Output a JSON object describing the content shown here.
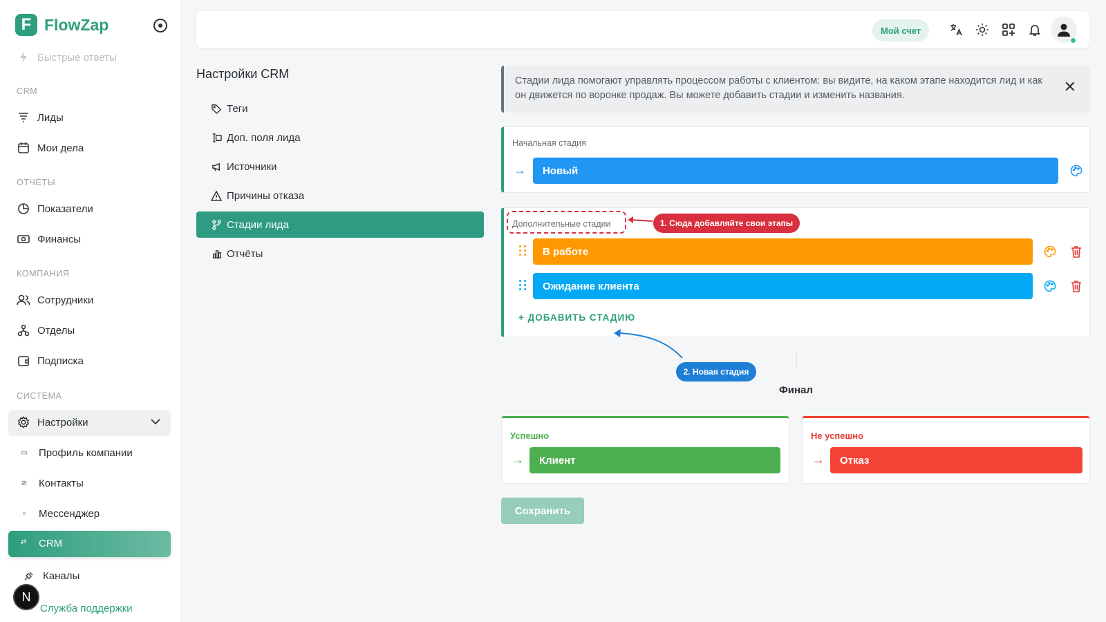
{
  "app": {
    "name": "FlowZap",
    "logo_letter": "F"
  },
  "sidebar": {
    "quick_replies": "Быстрые ответы",
    "sections": {
      "crm": "CRM",
      "reports": "ОТЧЁТЫ",
      "company": "КОМПАНИЯ",
      "system": "СИСТЕМА"
    },
    "items": {
      "leads": "Лиды",
      "my_tasks": "Мои дела",
      "metrics": "Показатели",
      "finance": "Финансы",
      "employees": "Сотрудники",
      "departments": "Отделы",
      "subscription": "Подписка",
      "settings": "Настройки",
      "company_profile": "Профиль компании",
      "contacts": "Контакты",
      "messenger": "Мессенджер",
      "crm": "CRM",
      "channels": "Каналы",
      "support": "Служба поддержки"
    },
    "bottom_avatar": "N"
  },
  "topbar": {
    "account": "Мой счет"
  },
  "crm_settings": {
    "title": "Настройки CRM",
    "menu": [
      {
        "label": "Теги",
        "icon": "tag-icon"
      },
      {
        "label": "Доп. поля лида",
        "icon": "fields-icon"
      },
      {
        "label": "Источники",
        "icon": "megaphone-icon"
      },
      {
        "label": "Причины отказа",
        "icon": "warning-icon"
      },
      {
        "label": "Стадии лида",
        "icon": "stages-icon"
      },
      {
        "label": "Отчёты",
        "icon": "chart-icon"
      }
    ]
  },
  "info": {
    "text": "Стадии лида помогают управлять процессом работы с клиентом: вы видите, на каком этапе находится лид и как он движется по воронке продаж. Вы можете добавить стадии и изменить названия.",
    "close": "✕"
  },
  "initial_stage": {
    "label": "Начальная стадия",
    "name": "Новый",
    "color": "#2196f3"
  },
  "extra_stages": {
    "label": "Дополнительные стадии",
    "stages": [
      {
        "name": "В работе",
        "color": "#ff9800"
      },
      {
        "name": "Ожидание клиента",
        "color": "#03a9f4"
      }
    ],
    "add_label": "+  ДОБАВИТЬ СТАДИЮ"
  },
  "annotations": {
    "callout1": "1. Сюда добавляйте свои этапы",
    "callout2": "2. Новая стадия"
  },
  "final": {
    "title": "Финал",
    "success": {
      "label": "Успешно",
      "name": "Клиент",
      "color": "#4caf50"
    },
    "fail": {
      "label": "Не успешно",
      "name": "Отказ",
      "color": "#f44336"
    }
  },
  "save_label": "Сохранить",
  "colors": {
    "brand": "#2e9e7e",
    "danger": "#d9303f",
    "callout_blue": "#1e7fd6"
  }
}
